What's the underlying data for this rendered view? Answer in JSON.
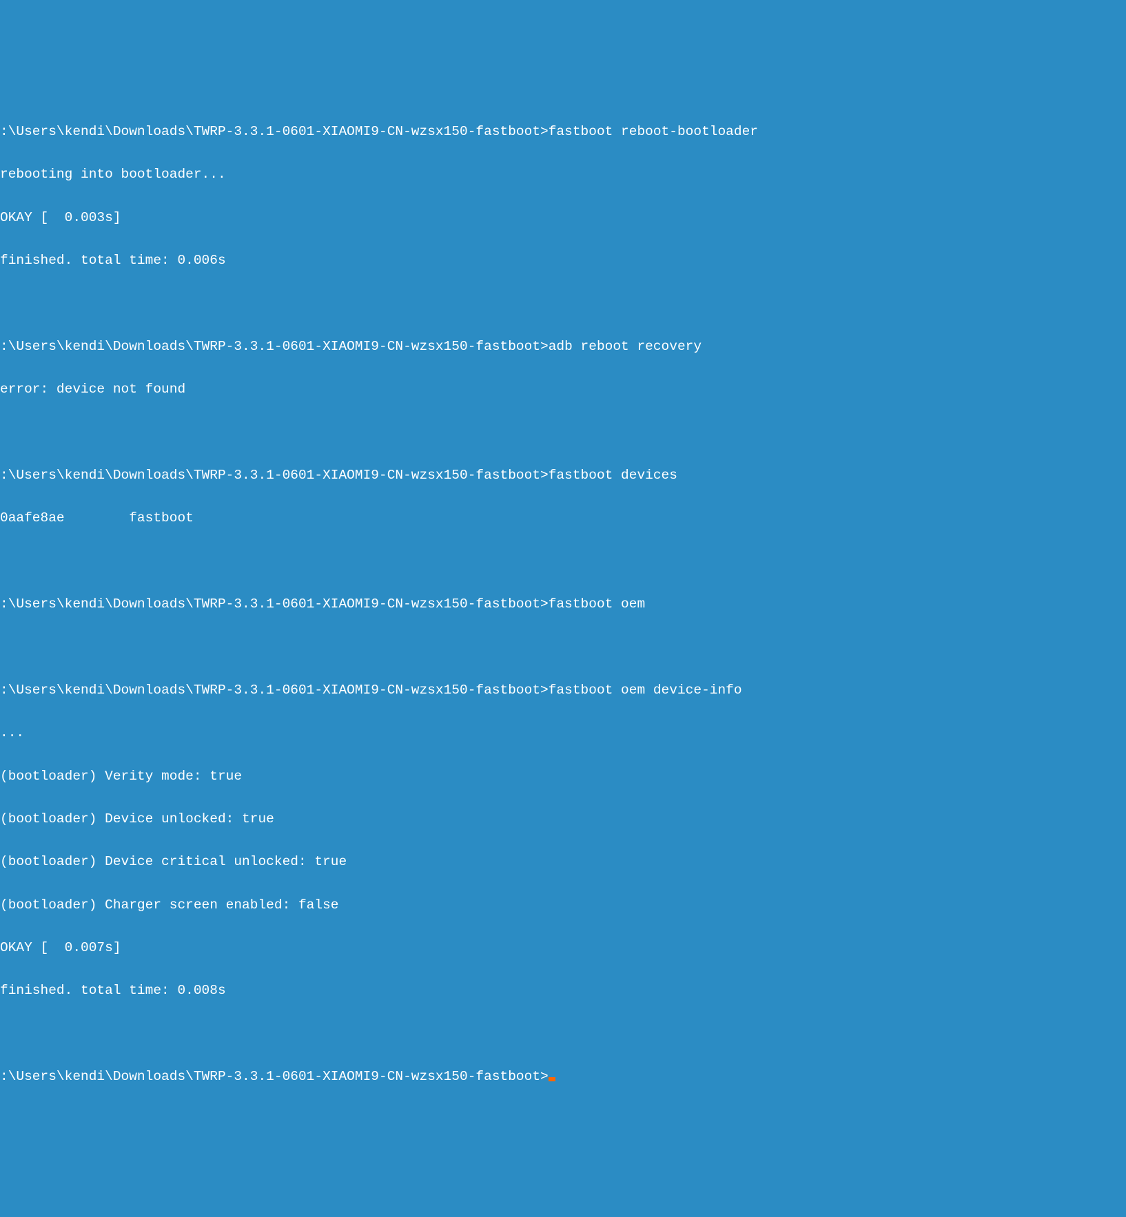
{
  "terminal": {
    "prompt": ":\\Users\\kendi\\Downloads\\TWRP-3.3.1-0601-XIAOMI9-CN-wzsx150-fastboot>",
    "blocks": [
      {
        "command": "fastboot reboot-bootloader",
        "output": [
          "rebooting into bootloader...",
          "OKAY [  0.003s]",
          "finished. total time: 0.006s"
        ]
      },
      {
        "command": "adb reboot recovery",
        "output": [
          "error: device not found"
        ]
      },
      {
        "command": "fastboot devices",
        "output": [
          "0aafe8ae        fastboot"
        ]
      },
      {
        "command": "fastboot oem",
        "output": []
      },
      {
        "command": "fastboot oem device-info",
        "output": [
          "...",
          "(bootloader) Verity mode: true",
          "(bootloader) Device unlocked: true",
          "(bootloader) Device critical unlocked: true",
          "(bootloader) Charger screen enabled: false",
          "OKAY [  0.007s]",
          "finished. total time: 0.008s"
        ]
      }
    ]
  }
}
